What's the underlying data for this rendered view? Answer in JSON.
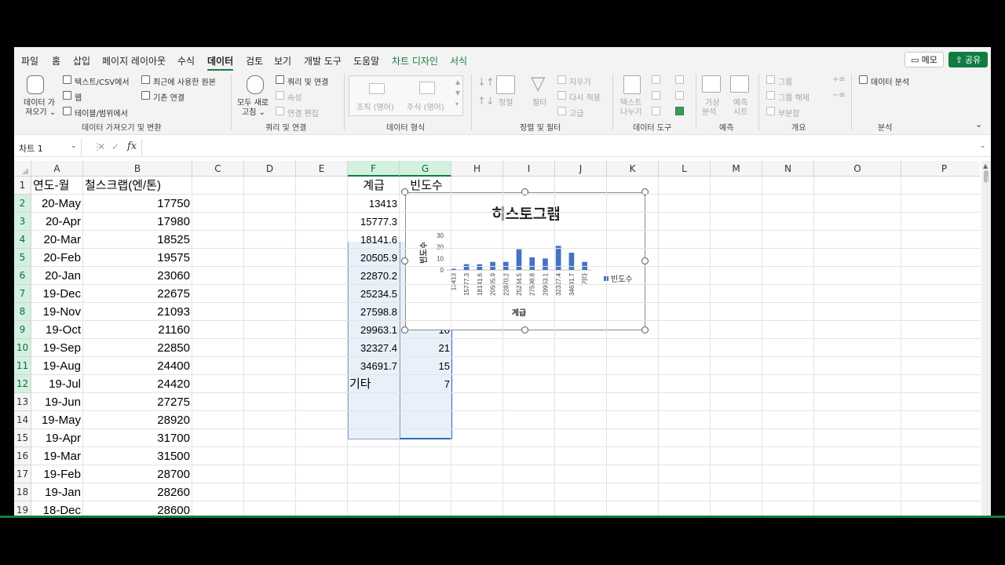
{
  "tabs": [
    "파일",
    "홈",
    "삽입",
    "페이지 레이아웃",
    "수식",
    "데이터",
    "검토",
    "보기",
    "개발 도구",
    "도움말",
    "차트 디자인",
    "서식"
  ],
  "active_tab": "데이터",
  "memo_label": "메모",
  "share_label": "공유",
  "ribbon": {
    "get_data": [
      "데이터 가",
      "져오기"
    ],
    "text_csv": "텍스트/CSV에서",
    "web": "웹",
    "table_range": "테이블/범위에서",
    "recent_source": "최근에 사용한 원본",
    "existing_conn": "기존 연결",
    "group_get": "데이터 가져오기 및 변환",
    "refresh_all": [
      "모두 새로",
      "고침"
    ],
    "queries_conn": "쿼리 및 연결",
    "properties": "속성",
    "edit_links": "연결 편집",
    "group_query": "쿼리 및 연결",
    "stocks": "조직 (영어)",
    "currency": "주식 (영어)",
    "group_types": "데이터 형식",
    "sort": "정렬",
    "filter": "필터",
    "clear": "지우기",
    "reapply": "다시 적용",
    "advanced": "고급",
    "group_sort": "정렬 및 필터",
    "text_to_cols": [
      "텍스트",
      "나누기"
    ],
    "group_tools": "데이터 도구",
    "whatif": [
      "가상",
      "분석"
    ],
    "forecast": [
      "예측",
      "시트"
    ],
    "group_forecast": "예측",
    "group_btn": "그룹",
    "ungroup_btn": "그룹 해제",
    "subtotal": "부분합",
    "group_outline": "개요",
    "data_analysis": "데이터 분석",
    "group_analysis": "분석"
  },
  "name_box": "차트 1",
  "columns": [
    "A",
    "B",
    "C",
    "D",
    "E",
    "F",
    "G",
    "H",
    "I",
    "J",
    "K",
    "L",
    "M",
    "N",
    "O",
    "P"
  ],
  "rows": [
    "1",
    "2",
    "3",
    "4",
    "5",
    "6",
    "7",
    "8",
    "9",
    "10",
    "11",
    "12",
    "13",
    "14",
    "15",
    "16",
    "17",
    "18",
    "19"
  ],
  "colA": [
    "연도-월",
    "20-May",
    "20-Apr",
    "20-Mar",
    "20-Feb",
    "20-Jan",
    "19-Dec",
    "19-Nov",
    "19-Oct",
    "19-Sep",
    "19-Aug",
    "19-Jul",
    "19-Jun",
    "19-May",
    "19-Apr",
    "19-Mar",
    "19-Feb",
    "19-Jan",
    "18-Dec"
  ],
  "colB": [
    "철스크랩(엔/톤)",
    "17750",
    "17980",
    "18525",
    "19575",
    "23060",
    "22675",
    "21093",
    "21160",
    "22850",
    "24400",
    "24420",
    "27275",
    "28920",
    "31700",
    "31500",
    "28700",
    "28260",
    "28600"
  ],
  "colF": [
    "계급",
    "13413",
    "15777.3",
    "18141.6",
    "20505.9",
    "22870.2",
    "25234.5",
    "27598.8",
    "29963.1",
    "32327.4",
    "34691.7",
    "기타"
  ],
  "colG": [
    "빈도수",
    "",
    "",
    "",
    "",
    "",
    "",
    "",
    "10",
    "21",
    "15",
    "7"
  ],
  "chart_data": {
    "type": "bar",
    "title": "히스토그램",
    "xlabel": "계급",
    "ylabel": "빈도수",
    "categories": [
      "13413",
      "15777.3",
      "18141.6",
      "20505.9",
      "22870.2",
      "25234.5",
      "27598.8",
      "29963.1",
      "32327.4",
      "34691.7",
      "기타"
    ],
    "series": [
      {
        "name": "빈도수",
        "values": [
          1,
          5,
          5,
          7,
          7,
          18,
          11,
          10,
          21,
          15,
          7
        ]
      }
    ],
    "ylim": [
      0,
      30
    ],
    "yticks": [
      "0",
      "10",
      "20",
      "30"
    ],
    "legend": "right",
    "bar_color": "#4472c4"
  }
}
